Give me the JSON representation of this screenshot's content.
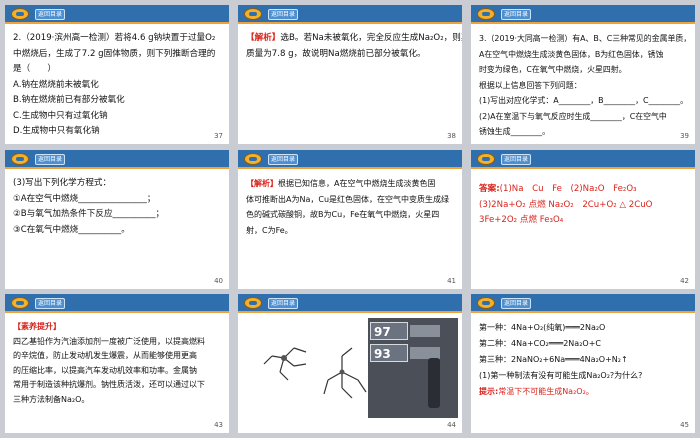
{
  "back_label": "返回目录",
  "slides": {
    "s37": {
      "num": "37",
      "lines": [
        "2.（2019·滨州高一检测）若将4.6 g钠块置于过量O₂",
        "中燃烧后，生成了7.2 g固体物质，则下列推断合理的",
        "是（　　）",
        "A.钠在燃烧前未被氧化",
        "B.钠在燃烧前已有部分被氧化",
        "C.生成物中只有过氧化钠",
        "D.生成物中只有氧化钠"
      ]
    },
    "s38": {
      "num": "38",
      "tag": "【解析】",
      "lines": [
        "选B。若Na未被氧化，完全反应生成Na₂O₂，则其",
        "质量为7.8 g，故说明Na燃烧前已部分被氧化。"
      ]
    },
    "s39": {
      "num": "39",
      "lines": [
        "3.（2019·大同高一检测）有A、B、C三种常见的金属单质，",
        "A在空气中燃烧生成淡黄色固体，B为红色固体，锈蚀",
        "时变为绿色，C在氧气中燃烧，火星四射。",
        "根据以上信息回答下列问题：",
        "(1)写出对应化学式：A________，B________，C________。",
        "(2)A在室温下与氧气反应时生成________，C在空气中",
        "锈蚀生成________。"
      ]
    },
    "s40": {
      "num": "40",
      "lines": [
        "(3)写出下列化学方程式：",
        "①A在空气中燃烧________________；",
        "②B与氧气加热条件下反应__________；",
        "③C在氧气中燃烧__________。"
      ]
    },
    "s41": {
      "num": "41",
      "tag": "【解析】",
      "lines": [
        "根据已知信息，A在空气中燃烧生成淡黄色固",
        "体可推断出A为Na，Cu是红色固体，在空气中变质生成绿",
        "色的碱式碳酸铜，故B为Cu，Fe在氧气中燃烧，火星四",
        "射，C为Fe。"
      ]
    },
    "s42": {
      "num": "42",
      "tag": "答案:",
      "lines": [
        "(1)Na　Cu　Fe　(2)Na₂O　Fe₂O₃",
        "(3)2Na+O₂ 点燃 Na₂O₂　2Cu+O₂ △ 2CuO",
        "3Fe+2O₂ 点燃 Fe₃O₄"
      ]
    },
    "s43": {
      "num": "43",
      "tag": "【素养提升】",
      "lines": [
        "四乙基铅作为汽油添加剂一度被广泛使用，以提高燃料",
        "的辛烷值，防止发动机发生爆震，从而能够使用更高",
        "的压缩比率，以提高汽车发动机效率和功率。金属钠",
        "常用于制造该种抗爆剂。钠性质活泼，还可以通过以下",
        "三种方法制备Na₂O。"
      ]
    },
    "s44": {
      "num": "44",
      "pump_97": "97",
      "pump_93": "93"
    },
    "s45": {
      "num": "45",
      "tag": "提示:",
      "lines": [
        "第一种：4Na+O₂(纯氧)═══2Na₂O",
        "第二种：4Na+CO₂═══2Na₂O+C",
        "第三种：2NaNO₂+6Na═══4Na₂O+N₂↑",
        "(1)第一种制法有没有可能生成Na₂O₂?为什么?"
      ],
      "hint": "常温下不可能生成Na₂O₂。"
    }
  }
}
